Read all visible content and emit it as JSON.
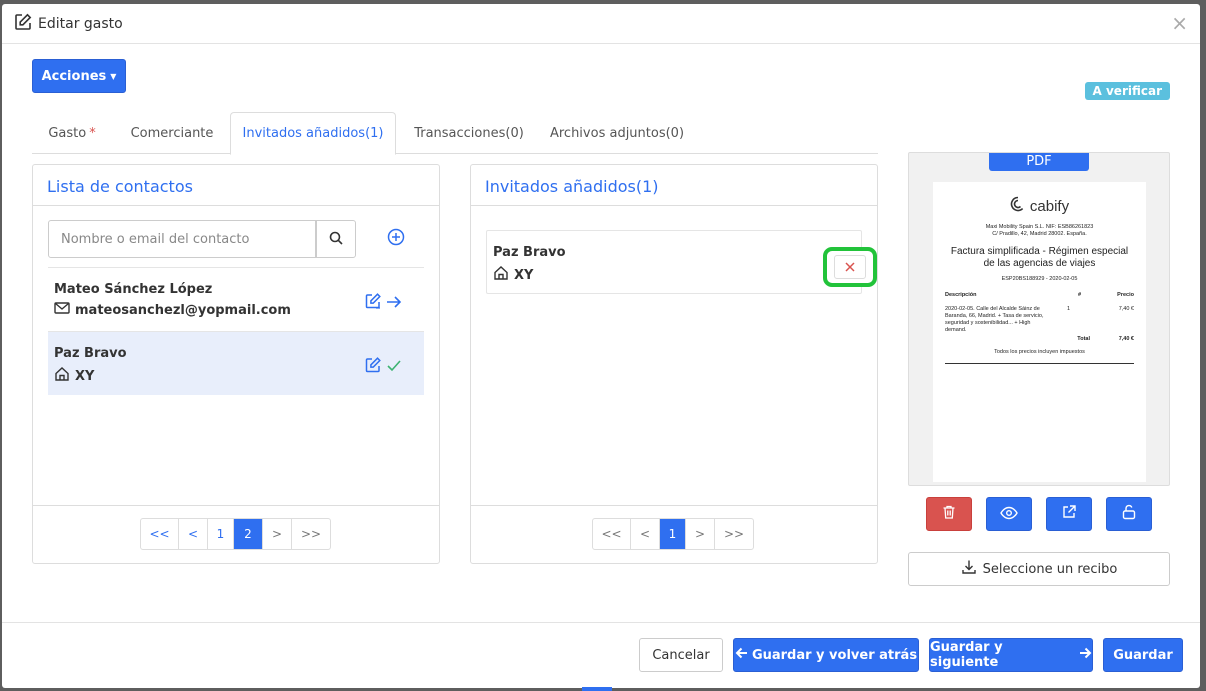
{
  "modal": {
    "title": "Editar gasto",
    "close_glyph": "×"
  },
  "actions_button": {
    "label": "Acciones"
  },
  "status_badge": "A verificar",
  "tabs": [
    {
      "label": "Gasto",
      "required_mark": "*"
    },
    {
      "label": "Comerciante"
    },
    {
      "label": "Invitados añadidos(1)"
    },
    {
      "label": "Transacciones(0)"
    },
    {
      "label": "Archivos adjuntos(0)"
    }
  ],
  "contacts_panel": {
    "title": "Lista de contactos",
    "search_placeholder": "Nombre o email del contacto",
    "contacts": [
      {
        "name": "Mateo Sánchez López",
        "detail": "mateosanchezl@yopmail.com",
        "detail_icon": "mail-icon"
      },
      {
        "name": "Paz Bravo",
        "detail": "XY",
        "detail_icon": "home-icon"
      }
    ],
    "pagination": [
      "<<",
      "<",
      "1",
      "2",
      ">",
      ">>"
    ],
    "current_page": "2"
  },
  "invited_panel": {
    "title": "Invitados añadidos(1)",
    "invitees": [
      {
        "name": "Paz Bravo",
        "detail": "XY",
        "detail_icon": "home-icon"
      }
    ],
    "pagination": [
      "<<",
      "<",
      "1",
      ">",
      ">>"
    ],
    "current_page": "1"
  },
  "receipt_preview": {
    "tag": "PDF",
    "brand": "cabify",
    "company_line1": "Maxi Mobility Spain S.L. NIF: ESB86261823",
    "company_line2": "C/ Pradillo, 42, Madrid 28002. España.",
    "title_line1": "Factura simplificada - Régimen especial",
    "title_line2": "de las agencias de viajes",
    "invoice_ref": "ESP20BS188929 - 2020-02-05",
    "col_desc": "Descripción",
    "col_qty": "#",
    "col_price": "Precio",
    "item_desc": "2020-02-05. Calle del Alcalde Sáinz de Baranda, 66, Madrid. + Tasa de servicio, seguridad y sostenibilidad... + High demand.",
    "item_qty": "1",
    "item_price": "7,40 €",
    "total_label": "Total",
    "total_value": "7,40 €",
    "footer_note": "Todos los precios incluyen impuestos"
  },
  "select_receipt": {
    "label": "Seleccione un recibo"
  },
  "footer": {
    "cancel": "Cancelar",
    "save_back": "Guardar y volver atrás",
    "save_next": "Guardar y siguiente",
    "save": "Guardar"
  },
  "colors": {
    "primary": "#2f6ff0",
    "danger": "#d9534f",
    "info": "#5bc0de",
    "highlight": "#22c33a",
    "success": "#3cb371"
  }
}
